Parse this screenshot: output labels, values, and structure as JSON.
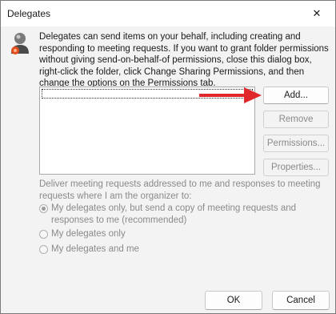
{
  "window": {
    "title": "Delegates",
    "close_symbol": "✕"
  },
  "description": "Delegates can send items on your behalf, including creating and responding to meeting requests. If you want to grant folder permissions without giving send-on-behalf-of permissions, close this dialog box, right-click the folder, click Change Sharing Permissions, and then change the options on the Permissions tab.",
  "buttons": {
    "add": "Add...",
    "remove": "Remove",
    "permissions": "Permissions...",
    "properties": "Properties...",
    "ok": "OK",
    "cancel": "Cancel"
  },
  "delivery": {
    "label": "Deliver meeting requests addressed to me and responses to meeting requests where I am the organizer to:",
    "options": [
      {
        "label": "My delegates only, but send a copy of meeting requests and responses to me (recommended)",
        "selected": true
      },
      {
        "label": "My delegates only",
        "selected": false
      },
      {
        "label": "My delegates and me",
        "selected": false
      }
    ]
  },
  "colors": {
    "arrow": "#e0282a",
    "accent": "#0067c0"
  }
}
